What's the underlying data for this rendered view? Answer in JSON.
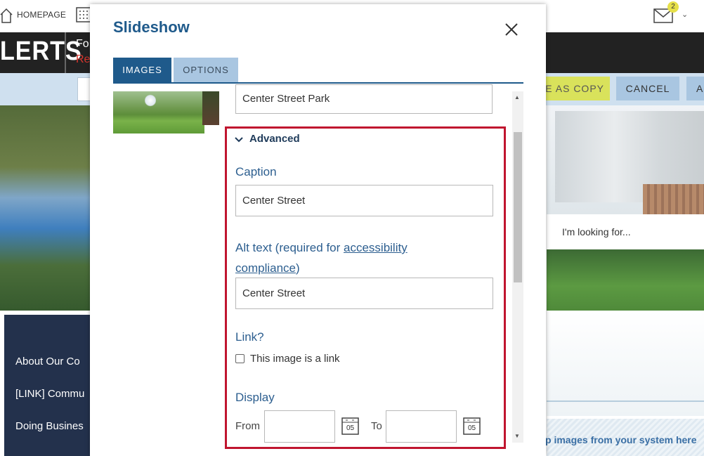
{
  "header": {
    "home_label": "HOMEPAGE",
    "mail_badge": "2"
  },
  "alerts": {
    "brand": "LERTS",
    "line1": "Fo",
    "line2": "Re"
  },
  "toolbar": {
    "save_copy_label": "E AS COPY",
    "cancel_label": "CANCEL",
    "apply_label": "A"
  },
  "search": {
    "placeholder": "I'm looking for..."
  },
  "side_nav": {
    "items": [
      "About Our Co",
      "[LINK] Commu",
      "Doing Busines"
    ]
  },
  "drop_zone": {
    "text": "p images from your system here"
  },
  "modal": {
    "title": "Slideshow",
    "tabs": [
      {
        "label": "IMAGES",
        "active": true
      },
      {
        "label": "OPTIONS",
        "active": false
      }
    ],
    "image_title_value": "Center Street Park",
    "advanced": {
      "toggle_label": "Advanced",
      "caption_label": "Caption",
      "caption_value": "Center Street",
      "alt_label_prefix": "Alt text (required for ",
      "alt_link_line1": "accessibility",
      "alt_link_line2": "compliance",
      "alt_label_suffix": ")",
      "alt_value": "Center Street",
      "link_label": "Link?",
      "link_checkbox_label": "This image is a link",
      "link_checked": false,
      "display_label": "Display",
      "from_label": "From",
      "to_label": "To",
      "from_value": "",
      "to_value": "",
      "calendar_day": "05"
    }
  },
  "colors": {
    "primary": "#1f5a8b",
    "tab_inactive": "#a9c6e1",
    "highlight_border": "#c0152f",
    "save_copy_bg": "#d9e25b",
    "side_nav_bg": "#23314c",
    "alert_bar_bg": "#222222"
  }
}
